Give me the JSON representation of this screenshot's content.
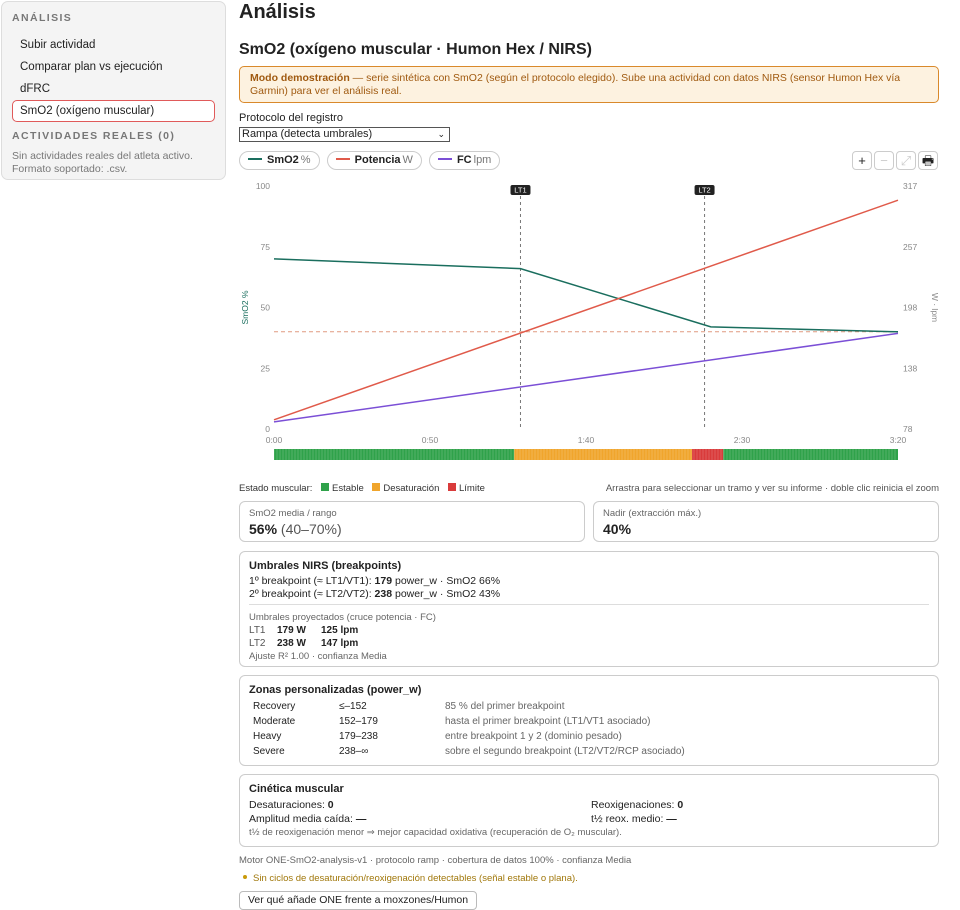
{
  "sidebar": {
    "heading": "ANÁLISIS",
    "items": [
      {
        "label": "Subir actividad"
      },
      {
        "label": "Comparar plan vs ejecución"
      },
      {
        "label": "dFRC"
      },
      {
        "label": "SmO2 (oxígeno muscular)",
        "active": true
      }
    ],
    "real_heading": "ACTIVIDADES REALES (0)",
    "real_note": "Sin actividades reales del atleta activo. Formato soportado: .csv."
  },
  "main": {
    "title": "Análisis",
    "section_title": "SmO2 (oxígeno muscular · Humon Hex / NIRS)",
    "banner_strong": "Modo demostración",
    "banner_text": " — serie sintética con SmO2 (según el protocolo elegido). Sube una actividad con datos NIRS (sensor Humon Hex vía Garmin) para ver el análisis real.",
    "protocol_label": "Protocolo del registro",
    "protocol_value": "Rampa (detecta umbrales)"
  },
  "legend": [
    {
      "name": "SmO2",
      "unit": "%",
      "color": "#1a6e5e"
    },
    {
      "name": "Potencia",
      "unit": "W",
      "color": "#e05a4a"
    },
    {
      "name": "FC",
      "unit": "lpm",
      "color": "#7b4fd6"
    }
  ],
  "toolbar": {
    "zoom_in": "+",
    "zoom_out": "−",
    "reset": "⤢",
    "print": "🖶"
  },
  "chart_data": {
    "type": "line",
    "x_ticks": [
      "0:00",
      "0:50",
      "1:40",
      "2:30",
      "3:20"
    ],
    "x_range_seconds": [
      0,
      200
    ],
    "y_left_label": "SmO2 %",
    "y_left_ticks": [
      "100",
      "75",
      "50",
      "25",
      "0"
    ],
    "y_left_range": [
      0,
      100
    ],
    "y_right_label": "W · lpm",
    "y_right_ticks": [
      "317",
      "257",
      "198",
      "138",
      "78"
    ],
    "y_right_range": [
      78,
      317
    ],
    "markers": [
      {
        "label": "LT1",
        "x": 79
      },
      {
        "label": "LT2",
        "x": 138
      }
    ],
    "smo2_reference": 40,
    "series": [
      {
        "name": "SmO2",
        "axis": "left",
        "color": "#1a6e5e",
        "points": [
          [
            0,
            70
          ],
          [
            79,
            66
          ],
          [
            140,
            42
          ],
          [
            200,
            40
          ]
        ]
      },
      {
        "name": "Potencia",
        "axis": "right",
        "color": "#e05a4a",
        "points": [
          [
            0,
            87
          ],
          [
            200,
            303
          ]
        ]
      },
      {
        "name": "FC",
        "axis": "right",
        "color": "#7b4fd6",
        "points": [
          [
            0,
            85
          ],
          [
            200,
            172
          ]
        ]
      }
    ],
    "state_band": [
      {
        "state": "Estable",
        "from": 0,
        "to": 77,
        "color": "#2fa24a"
      },
      {
        "state": "Desaturación",
        "from": 77,
        "to": 134,
        "color": "#f0a52c"
      },
      {
        "state": "Límite",
        "from": 134,
        "to": 144,
        "color": "#d93b3b"
      },
      {
        "state": "Estable",
        "from": 144,
        "to": 200,
        "color": "#2fa24a"
      }
    ]
  },
  "status": {
    "label": "Estado muscular:",
    "items": [
      {
        "name": "Estable",
        "color": "#2fa24a"
      },
      {
        "name": "Desaturación",
        "color": "#f0a52c"
      },
      {
        "name": "Límite",
        "color": "#d93b3b"
      }
    ],
    "hint": "Arrastra para seleccionar un tramo y ver su informe · doble clic reinicia el zoom"
  },
  "stats": {
    "mean_label": "SmO2 media / rango",
    "mean_value": "56%",
    "mean_range": "(40–70%)",
    "nadir_label": "Nadir (extracción máx.)",
    "nadir_value": "40%"
  },
  "thresholds": {
    "title": "Umbrales NIRS (breakpoints)",
    "bp1_prefix": "1º breakpoint (≈ LT1/VT1): ",
    "bp1_value": "179",
    "bp1_suffix": " power_w · SmO2 66%",
    "bp2_prefix": "2º breakpoint (≈ LT2/VT2): ",
    "bp2_value": "238",
    "bp2_suffix": " power_w · SmO2 43%",
    "projected_title": "Umbrales proyectados (cruce potencia · FC)",
    "rows": [
      {
        "name": "LT1",
        "power": "179 W",
        "hr": "125 lpm"
      },
      {
        "name": "LT2",
        "power": "238 W",
        "hr": "147 lpm"
      }
    ],
    "fit": "Ajuste R² 1.00 · confianza Media"
  },
  "zones": {
    "title": "Zonas personalizadas (power_w)",
    "rows": [
      {
        "name": "Recovery",
        "range": "≤–152",
        "desc": "85 % del primer breakpoint"
      },
      {
        "name": "Moderate",
        "range": "152–179",
        "desc": "hasta el primer breakpoint (LT1/VT1 asociado)"
      },
      {
        "name": "Heavy",
        "range": "179–238",
        "desc": "entre breakpoint 1 y 2 (dominio pesado)"
      },
      {
        "name": "Severe",
        "range": "238–∞",
        "desc": "sobre el segundo breakpoint (LT2/VT2/RCP asociado)"
      }
    ]
  },
  "kinetics": {
    "title": "Cinética muscular",
    "desat_label": "Desaturaciones: ",
    "desat_value": "0",
    "reox_label": "Reoxigenaciones: ",
    "reox_value": "0",
    "amp_label": "Amplitud media caída: ",
    "amp_value": "—",
    "half_label": "t½ reox. medio: ",
    "half_value": "—",
    "note": "t½ de reoxigenación menor ⇒ mejor capacidad oxidativa (recuperación de O₂ muscular)."
  },
  "footer": {
    "engine": "Motor ONE-SmO2-analysis-v1 · protocolo ramp · cobertura de datos 100% · confianza Media",
    "warning": "Sin ciclos de desaturación/reoxigenación detectables (señal estable o plana).",
    "why_button": "Ver qué añade ONE frente a moxzones/Humon"
  }
}
